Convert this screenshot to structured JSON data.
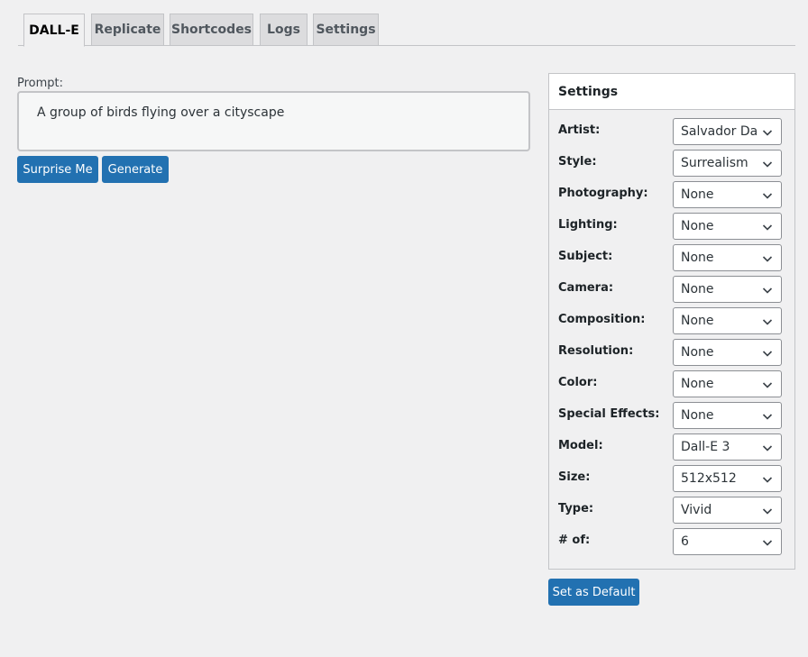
{
  "tabs": [
    {
      "label": "DALL-E",
      "active": true
    },
    {
      "label": "Replicate",
      "active": false
    },
    {
      "label": "Shortcodes",
      "active": false
    },
    {
      "label": "Logs",
      "active": false
    },
    {
      "label": "Settings",
      "active": false
    }
  ],
  "prompt": {
    "label": "Prompt:",
    "value": "A group of birds flying over a cityscape"
  },
  "buttons": {
    "surprise_label": "Surprise Me",
    "generate_label": "Generate",
    "set_default_label": "Set as Default"
  },
  "settings": {
    "title": "Settings",
    "rows": [
      {
        "label": "Artist:",
        "value": "Salvador Dalí"
      },
      {
        "label": "Style:",
        "value": "Surrealism"
      },
      {
        "label": "Photography:",
        "value": "None"
      },
      {
        "label": "Lighting:",
        "value": "None"
      },
      {
        "label": "Subject:",
        "value": "None"
      },
      {
        "label": "Camera:",
        "value": "None"
      },
      {
        "label": "Composition:",
        "value": "None"
      },
      {
        "label": "Resolution:",
        "value": "None"
      },
      {
        "label": "Color:",
        "value": "None"
      },
      {
        "label": "Special Effects:",
        "value": "None"
      },
      {
        "label": "Model:",
        "value": "Dall-E 3"
      },
      {
        "label": "Size:",
        "value": "512x512"
      },
      {
        "label": "Type:",
        "value": "Vivid"
      },
      {
        "label": "# of:",
        "value": "6"
      }
    ]
  },
  "icons": {
    "dropdown": "chevron-down-icon"
  },
  "colors": {
    "primary_button": "#2271b1",
    "background": "#f0f0f1"
  }
}
